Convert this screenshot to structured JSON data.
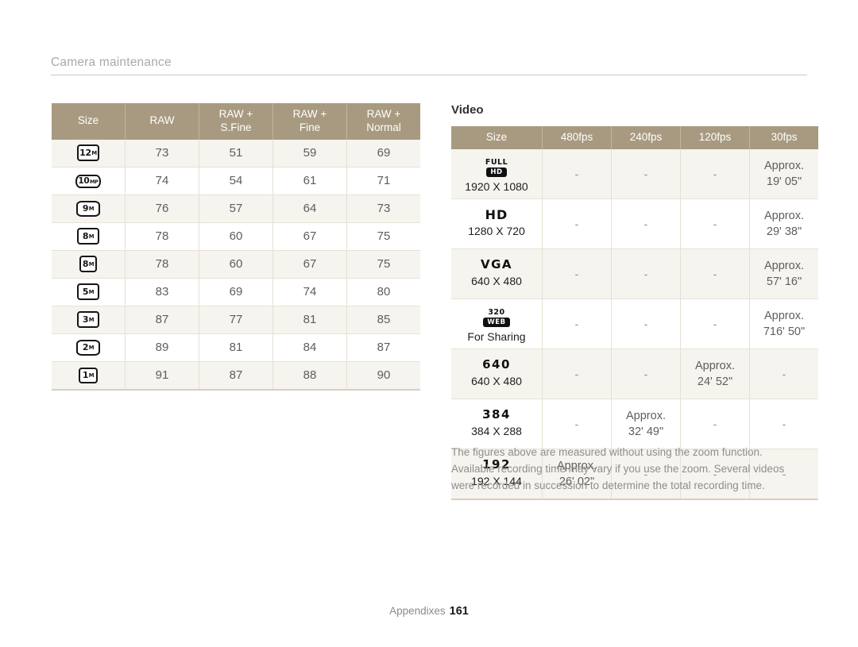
{
  "page": {
    "section_title": "Camera maintenance",
    "footer_label": "Appendixes",
    "footer_page": "161"
  },
  "photo_table": {
    "headers": [
      "Size",
      "RAW",
      "RAW +\nS.Fine",
      "RAW +\nFine",
      "RAW +\nNormal"
    ],
    "header_size": "Size",
    "header_raw": "RAW",
    "header_raw_sfine_l1": "RAW +",
    "header_raw_sfine_l2": "S.Fine",
    "header_raw_fine_l1": "RAW +",
    "header_raw_fine_l2": "Fine",
    "header_raw_normal_l1": "RAW +",
    "header_raw_normal_l2": "Normal",
    "rows": [
      {
        "icon": "res-12m-icon",
        "num": "12",
        "unit": "M",
        "ar": "ar-43",
        "raw": "73",
        "raw_sfine": "51",
        "raw_fine": "59",
        "raw_normal": "69"
      },
      {
        "icon": "res-10mp-icon",
        "num": "10",
        "unit": "MP",
        "ar": "ar-wide",
        "raw": "74",
        "raw_sfine": "54",
        "raw_fine": "61",
        "raw_normal": "71"
      },
      {
        "icon": "res-9m-icon",
        "num": "9",
        "unit": "M",
        "ar": "ar-32",
        "raw": "76",
        "raw_sfine": "57",
        "raw_fine": "64",
        "raw_normal": "73"
      },
      {
        "icon": "res-8m-icon",
        "num": "8",
        "unit": "M",
        "ar": "ar-43",
        "raw": "78",
        "raw_sfine": "60",
        "raw_fine": "67",
        "raw_normal": "75"
      },
      {
        "icon": "res-8m-alt-icon",
        "num": "8",
        "unit": "M",
        "ar": "ar-sq",
        "raw": "78",
        "raw_sfine": "60",
        "raw_fine": "67",
        "raw_normal": "75"
      },
      {
        "icon": "res-5m-icon",
        "num": "5",
        "unit": "M",
        "ar": "ar-43",
        "raw": "83",
        "raw_sfine": "69",
        "raw_fine": "74",
        "raw_normal": "80"
      },
      {
        "icon": "res-3m-icon",
        "num": "3",
        "unit": "M",
        "ar": "ar-43",
        "raw": "87",
        "raw_sfine": "77",
        "raw_fine": "81",
        "raw_normal": "85"
      },
      {
        "icon": "res-2m-icon",
        "num": "2",
        "unit": "M",
        "ar": "ar-32",
        "raw": "89",
        "raw_sfine": "81",
        "raw_fine": "84",
        "raw_normal": "87"
      },
      {
        "icon": "res-1m-icon",
        "num": "1",
        "unit": "M",
        "ar": "ar-11",
        "raw": "91",
        "raw_sfine": "87",
        "raw_fine": "88",
        "raw_normal": "90"
      }
    ]
  },
  "video_section": {
    "heading": "Video",
    "headers": {
      "size": "Size",
      "fps480": "480fps",
      "fps240": "240fps",
      "fps120": "120fps",
      "fps30": "30fps"
    },
    "dash": "-",
    "approx_label": "Approx.",
    "rows": [
      {
        "icon": "full-hd-icon",
        "logo_top": "FULL",
        "logo_chip": "HD",
        "logo_text": "",
        "dimensions": "1920 X 1080",
        "fps480": "-",
        "fps240": "-",
        "fps120": "-",
        "fps30_approx": "Approx.",
        "fps30_time": "19' 05\""
      },
      {
        "icon": "hd-icon",
        "logo_top": "",
        "logo_chip": "",
        "logo_text": "HD",
        "dimensions": "1280 X 720",
        "fps480": "-",
        "fps240": "-",
        "fps120": "-",
        "fps30_approx": "Approx.",
        "fps30_time": "29' 38\""
      },
      {
        "icon": "vga-icon",
        "logo_top": "",
        "logo_chip": "",
        "logo_text": "VGA",
        "dimensions": "640 X 480",
        "fps480": "-",
        "fps240": "-",
        "fps120": "-",
        "fps30_approx": "Approx.",
        "fps30_time": "57' 16\""
      },
      {
        "icon": "web-320-icon",
        "logo_top": "320",
        "logo_chip": "WEB",
        "logo_text": "",
        "dimensions": "For Sharing",
        "fps480": "-",
        "fps240": "-",
        "fps120": "-",
        "fps30_approx": "Approx.",
        "fps30_time": "716' 50\""
      },
      {
        "icon": "res-640-icon",
        "logo_top": "",
        "logo_chip": "",
        "logo_text": "640",
        "dimensions": "640 X 480",
        "fps480": "-",
        "fps240": "-",
        "fps120_approx": "Approx.",
        "fps120_time": "24' 52\"",
        "fps30": "-"
      },
      {
        "icon": "res-384-icon",
        "logo_top": "",
        "logo_chip": "",
        "logo_text": "384",
        "dimensions": "384 X 288",
        "fps480": "-",
        "fps240_approx": "Approx.",
        "fps240_time": "32' 49\"",
        "fps120": "-",
        "fps30": "-"
      },
      {
        "icon": "res-192-icon",
        "logo_top": "",
        "logo_chip": "",
        "logo_text": "192",
        "dimensions": "192 X 144",
        "fps480_approx": "Approx.",
        "fps480_time": "26' 02\"",
        "fps240": "-",
        "fps120": "-",
        "fps30": "-"
      }
    ],
    "note": "The figures above are measured without using the zoom function. Available recording time may vary if you use the zoom. Several videos were recorded in succession to determine the total recording time."
  },
  "colors": {
    "table_header_bg": "#a89a80",
    "row_alt_bg": "#f6f4ef",
    "text_muted": "#8e8e8e"
  }
}
